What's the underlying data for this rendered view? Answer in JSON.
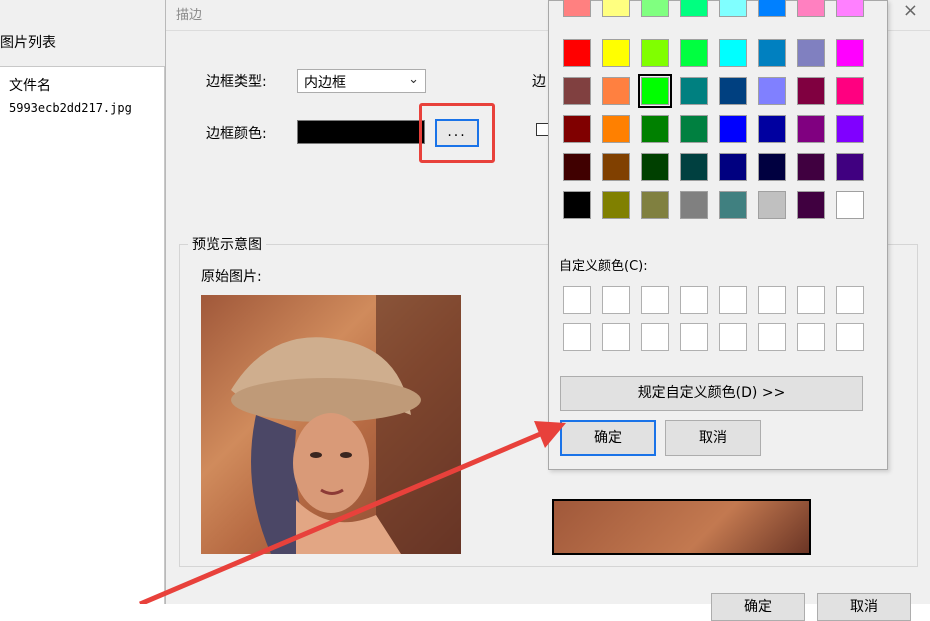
{
  "left_pane": {
    "title": "图片列表",
    "column_header": "文件名",
    "files": [
      "5993ecb2dd217.jpg"
    ]
  },
  "dialog": {
    "title": "描边",
    "close_icon": "×",
    "border_type_label": "边框类型:",
    "border_type_value": "内边框",
    "border_color_label": "边框颜色:",
    "border_color_value": "#000000",
    "ellipsis_label": "...",
    "right_label_partial": "边",
    "preview_title": "预览示意图",
    "original_label": "原始图片:",
    "ok": "确定",
    "cancel": "取消"
  },
  "color_picker": {
    "basic_colors": [
      [
        "#ff8080",
        "#ffff80",
        "#80ff80",
        "#00ff80",
        "#80ffff",
        "#0080ff",
        "#ff80c0",
        "#ff80ff"
      ],
      [
        "#ff0000",
        "#ffff00",
        "#80ff00",
        "#00ff40",
        "#00ffff",
        "#0080c0",
        "#8080c0",
        "#ff00ff"
      ],
      [
        "#804040",
        "#ff8040",
        "#00ff00",
        "#008080",
        "#004080",
        "#8080ff",
        "#800040",
        "#ff0080"
      ],
      [
        "#800000",
        "#ff8000",
        "#008000",
        "#008040",
        "#0000ff",
        "#0000a0",
        "#800080",
        "#8000ff"
      ],
      [
        "#400000",
        "#804000",
        "#004000",
        "#004040",
        "#000080",
        "#000040",
        "#400040",
        "#400080"
      ],
      [
        "#000000",
        "#808000",
        "#808040",
        "#808080",
        "#408080",
        "#c0c0c0",
        "#400040",
        "#ffffff"
      ]
    ],
    "selected_color": "#00ff00",
    "custom_label": "自定义颜色(C):",
    "define_custom_label": "规定自定义颜色(D) >>",
    "ok": "确定",
    "cancel": "取消"
  },
  "annotation": {
    "color": "#e8413b"
  }
}
